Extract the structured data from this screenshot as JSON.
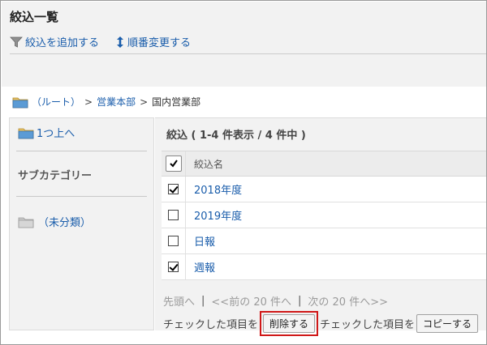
{
  "header": {
    "title": "絞込一覧",
    "add_filter": "絞込を追加する",
    "reorder": "順番変更する"
  },
  "breadcrumb": {
    "root": "（ルート）",
    "sep1": ">",
    "level1": "営業本部",
    "sep2": ">",
    "current": "国内営業部"
  },
  "sidebar": {
    "up": "1つ上へ",
    "subcategory": "サブカテゴリー",
    "uncategorized": "（未分類）"
  },
  "list": {
    "count_label": "絞込 ( 1-4 件表示 / 4 件中 )",
    "column_name": "絞込名",
    "rows": [
      {
        "name": "2018年度",
        "checked": true
      },
      {
        "name": "2019年度",
        "checked": false
      },
      {
        "name": "日報",
        "checked": false
      },
      {
        "name": "週報",
        "checked": true
      }
    ]
  },
  "pager": {
    "first": "先頭へ",
    "bar1": "|",
    "prev": "<<前の 20 件へ",
    "bar2": "|",
    "next": "次の 20 件へ>>"
  },
  "actions": {
    "checked_label_1": "チェックした項目を",
    "delete_button": "削除する",
    "checked_label_2": "チェックした項目を",
    "copy_button": "コピーする"
  }
}
